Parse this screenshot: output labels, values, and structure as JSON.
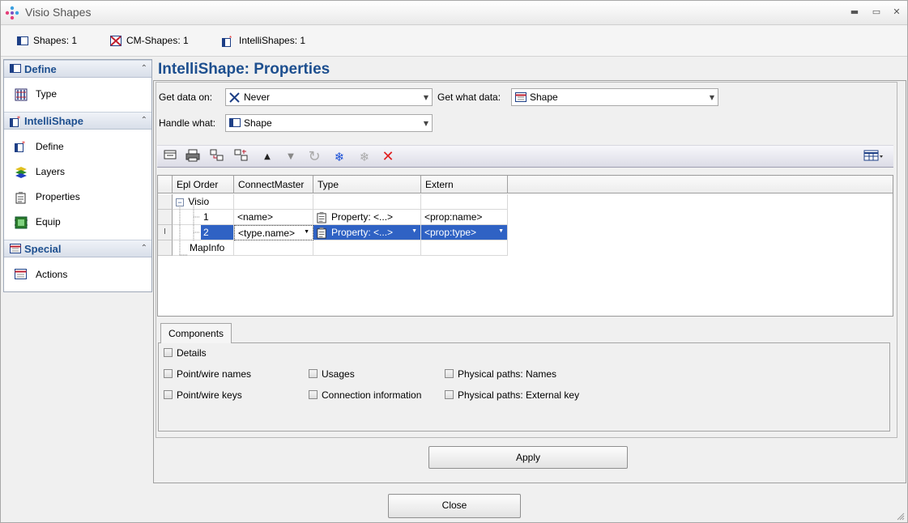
{
  "window": {
    "title": "Visio Shapes",
    "controls": {
      "minimize": "▬",
      "maximize": "▭",
      "close": "✕"
    }
  },
  "shapebar": {
    "items": [
      {
        "label": "Shapes:",
        "count": "1",
        "icon": "shape-icon"
      },
      {
        "label": "CM-Shapes:",
        "count": "1",
        "icon": "cm-shape-icon"
      },
      {
        "label": "IntelliShapes:",
        "count": "1",
        "icon": "intellishape-icon"
      }
    ]
  },
  "nav": {
    "sections": [
      {
        "title": "Define",
        "items": [
          {
            "label": "Type"
          }
        ]
      },
      {
        "title": "IntelliShape",
        "items": [
          {
            "label": "Define"
          },
          {
            "label": "Layers"
          },
          {
            "label": "Properties"
          },
          {
            "label": "Equip"
          }
        ]
      },
      {
        "title": "Special",
        "items": [
          {
            "label": "Actions"
          }
        ]
      }
    ],
    "collapse_glyph": "⌃"
  },
  "main": {
    "title": "IntelliShape:  Properties",
    "get_data_on": {
      "label": "Get data on:",
      "value": "Never"
    },
    "get_what_data": {
      "label": "Get what data:",
      "value": "Shape"
    },
    "handle_what": {
      "label": "Handle what:",
      "value": "Shape"
    }
  },
  "grid": {
    "columns": [
      "Epl Order",
      "ConnectMaster",
      "Type",
      "Extern"
    ],
    "rows": [
      {
        "order": "Visio",
        "connect": "",
        "type": "",
        "extern": ""
      },
      {
        "order": "1",
        "connect": "<name>",
        "type": "Property: <...>",
        "extern": "<prop:name>"
      },
      {
        "order": "2",
        "connect": "<type.name>",
        "type": "Property: <...>",
        "extern": "<prop:type>"
      },
      {
        "order": "MapInfo",
        "connect": "",
        "type": "",
        "extern": ""
      }
    ],
    "tree_toggle": "−"
  },
  "components": {
    "tab": "Components",
    "checks": {
      "details": "Details",
      "point_wire_names": "Point/wire names",
      "point_wire_keys": "Point/wire keys",
      "usages": "Usages",
      "connection_information": "Connection information",
      "physical_paths_names": "Physical paths: Names",
      "physical_paths_external_key": "Physical paths: External key"
    }
  },
  "buttons": {
    "apply": "Apply",
    "close": "Close"
  },
  "colors": {
    "accent": "#1d4f8f",
    "selection": "#2f62c4",
    "delete": "#e02020",
    "snowflake": "#1a4fd6"
  }
}
